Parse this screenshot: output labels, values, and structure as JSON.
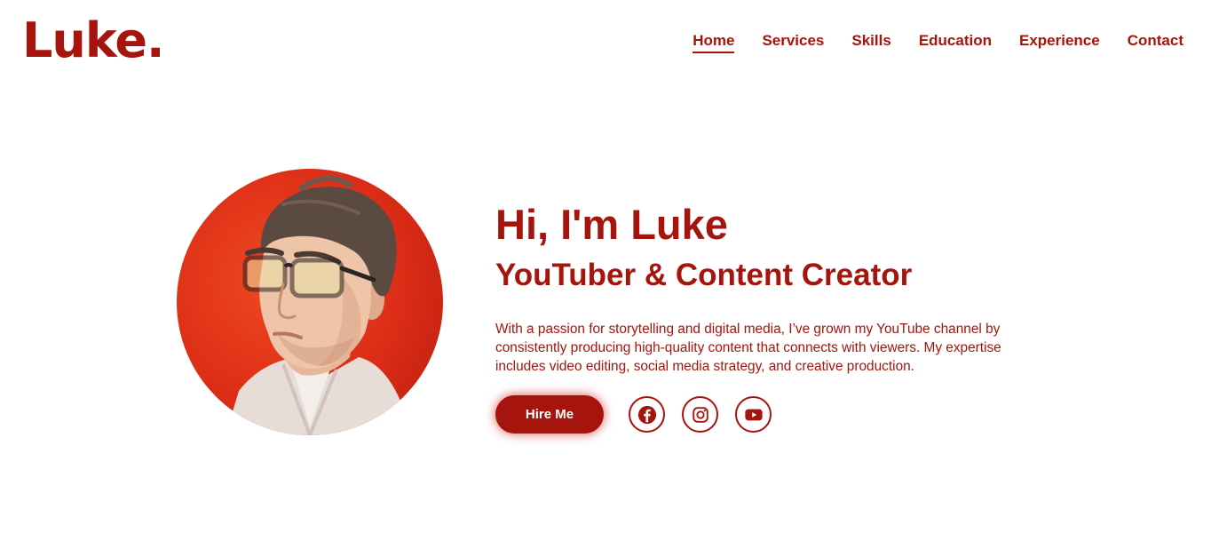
{
  "brand": {
    "logo": "Luke."
  },
  "nav": {
    "items": [
      {
        "label": "Home",
        "active": true
      },
      {
        "label": "Services"
      },
      {
        "label": "Skills"
      },
      {
        "label": "Education"
      },
      {
        "label": "Experience"
      },
      {
        "label": "Contact"
      }
    ]
  },
  "hero": {
    "greeting": "Hi, I'm Luke",
    "role": "YouTuber & Content Creator",
    "bio": "With a passion for storytelling and digital media, I’ve grown my YouTube channel by consistently producing high-quality content that connects with viewers. My expertise includes video editing, social media strategy, and creative production.",
    "cta_label": "Hire Me",
    "socials": [
      "facebook-icon",
      "instagram-icon",
      "youtube-icon"
    ]
  },
  "colors": {
    "accent": "#a5150d",
    "avatar_background": "#dc2d16",
    "background": "#ffffff"
  }
}
